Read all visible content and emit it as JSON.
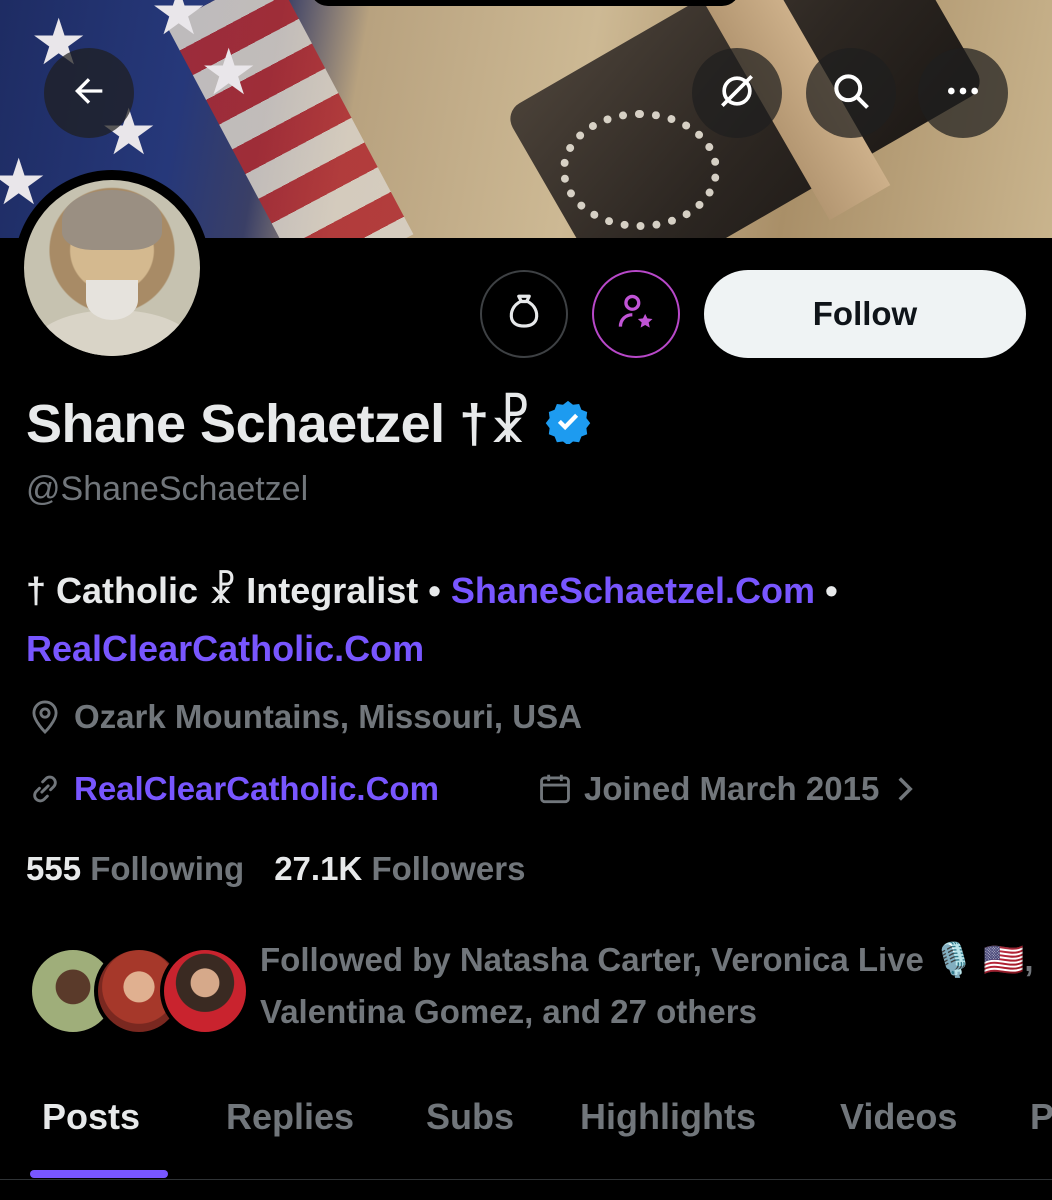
{
  "header": {
    "back_icon": "arrow-left-icon",
    "grok_icon": "grok-icon",
    "search_icon": "search-icon",
    "more_icon": "more-icon"
  },
  "profile": {
    "name": "Shane Schaetzel †☧",
    "handle": "@ShaneSchaetzel",
    "verified_color": "#1d9bf0",
    "follow_label": "Follow",
    "bio_prefix": "† Catholic ☧ Integralist •",
    "bio_link1": "ShaneSchaetzel.Com",
    "bio_sep": "•",
    "bio_link2": "RealClearCatholic.Com",
    "location": "Ozark Mountains, Missouri, USA",
    "website": "RealClearCatholic.Com",
    "joined": "Joined March 2015",
    "following_count": "555",
    "following_label": "Following",
    "followers_count": "27.1K",
    "followers_label": "Followers",
    "followed_by": "Followed by Natasha Carter, Veronica Live 🎙️ 🇺🇸, Valentina Gomez, and 27 others"
  },
  "tabs": [
    {
      "label": "Posts"
    },
    {
      "label": "Replies"
    },
    {
      "label": "Subs"
    },
    {
      "label": "Highlights"
    },
    {
      "label": "Videos"
    },
    {
      "label": "P"
    }
  ],
  "colors": {
    "accent": "#7856ff",
    "subscribe_border": "#b848c9",
    "muted": "#71767b"
  }
}
